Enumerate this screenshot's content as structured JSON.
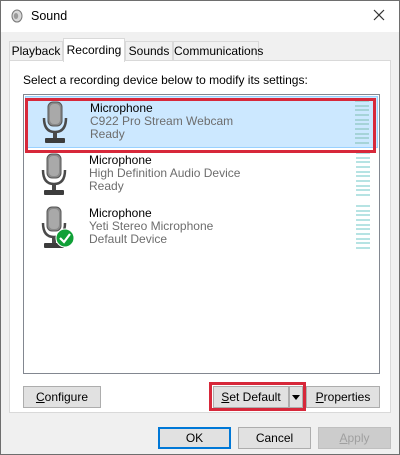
{
  "window": {
    "title": "Sound"
  },
  "tabs": [
    {
      "label": "Playback"
    },
    {
      "label": "Recording"
    },
    {
      "label": "Sounds"
    },
    {
      "label": "Communications"
    }
  ],
  "instruction": "Select a recording device below to modify its settings:",
  "devices": [
    {
      "name": "Microphone",
      "description": "C922 Pro Stream Webcam",
      "status": "Ready",
      "selected": true,
      "is_default": false
    },
    {
      "name": "Microphone",
      "description": "High Definition Audio Device",
      "status": "Ready",
      "selected": false,
      "is_default": false
    },
    {
      "name": "Microphone",
      "description": "Yeti Stereo Microphone",
      "status": "Default Device",
      "selected": false,
      "is_default": true
    }
  ],
  "buttons": {
    "configure": {
      "mnemonic": "C",
      "rest": "onfigure"
    },
    "set_default": {
      "mnemonic": "S",
      "rest": "et Default"
    },
    "properties": {
      "mnemonic": "P",
      "rest": "roperties"
    },
    "ok": "OK",
    "cancel": "Cancel",
    "apply": {
      "mnemonic": "A",
      "rest": "pply"
    }
  },
  "colors": {
    "selection": "#cce8ff",
    "highlight": "#d7283a",
    "default_check": "#10a037",
    "focus_border": "#0078d7"
  },
  "icons": {
    "title": "speaker-icon",
    "close": "close-icon",
    "device": "microphone-icon",
    "default": "check-badge-icon",
    "dropdown": "dropdown-arrow-icon"
  }
}
